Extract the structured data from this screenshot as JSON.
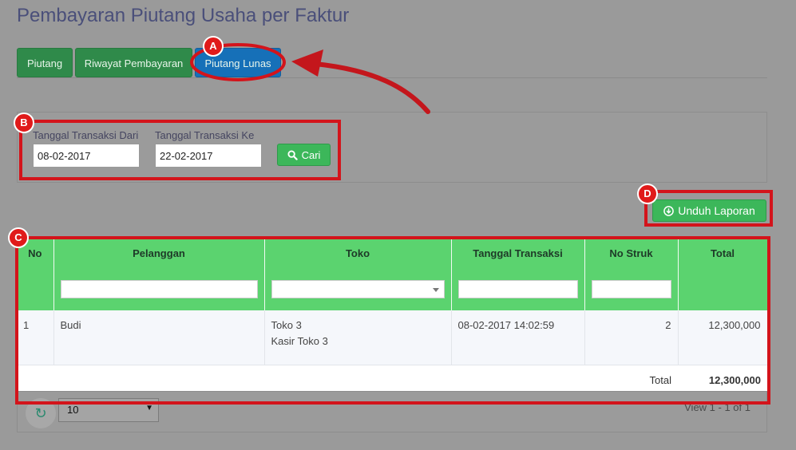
{
  "page": {
    "title": "Pembayaran Piutang Usaha per Faktur"
  },
  "tabs": [
    {
      "label": "Piutang",
      "active": false
    },
    {
      "label": "Riwayat Pembayaran",
      "active": false
    },
    {
      "label": "Piutang Lunas",
      "active": true
    }
  ],
  "filter": {
    "from_label": "Tanggal Transaksi Dari",
    "from_value": "08-02-2017",
    "to_label": "Tanggal Transaksi Ke",
    "to_value": "22-02-2017",
    "search_label": "Cari",
    "search_icon": "search-icon"
  },
  "download": {
    "label": "Unduh Laporan",
    "icon": "download-circle-icon"
  },
  "grid": {
    "columns": [
      "No",
      "Pelanggan",
      "Toko",
      "Tanggal Transaksi",
      "No Struk",
      "Total"
    ],
    "rows": [
      {
        "no": "1",
        "pelanggan": "Budi",
        "toko": "Toko 3",
        "kasir": "Kasir Toko 3",
        "tanggal": "08-02-2017 14:02:59",
        "no_struk": "2",
        "total": "12,300,000"
      }
    ],
    "total_label": "Total",
    "total_value": "12,300,000"
  },
  "footer": {
    "page_size": "10",
    "view_info": "View 1 - 1 of 1",
    "refresh_icon": "refresh-icon"
  },
  "annotations": {
    "a": "A",
    "b": "B",
    "c": "C",
    "d": "D"
  },
  "colors": {
    "accent_green": "#5bd36f",
    "tab_green": "#2f8a4a",
    "tab_active": "#1670b8",
    "annotation_red": "#d3141b"
  }
}
